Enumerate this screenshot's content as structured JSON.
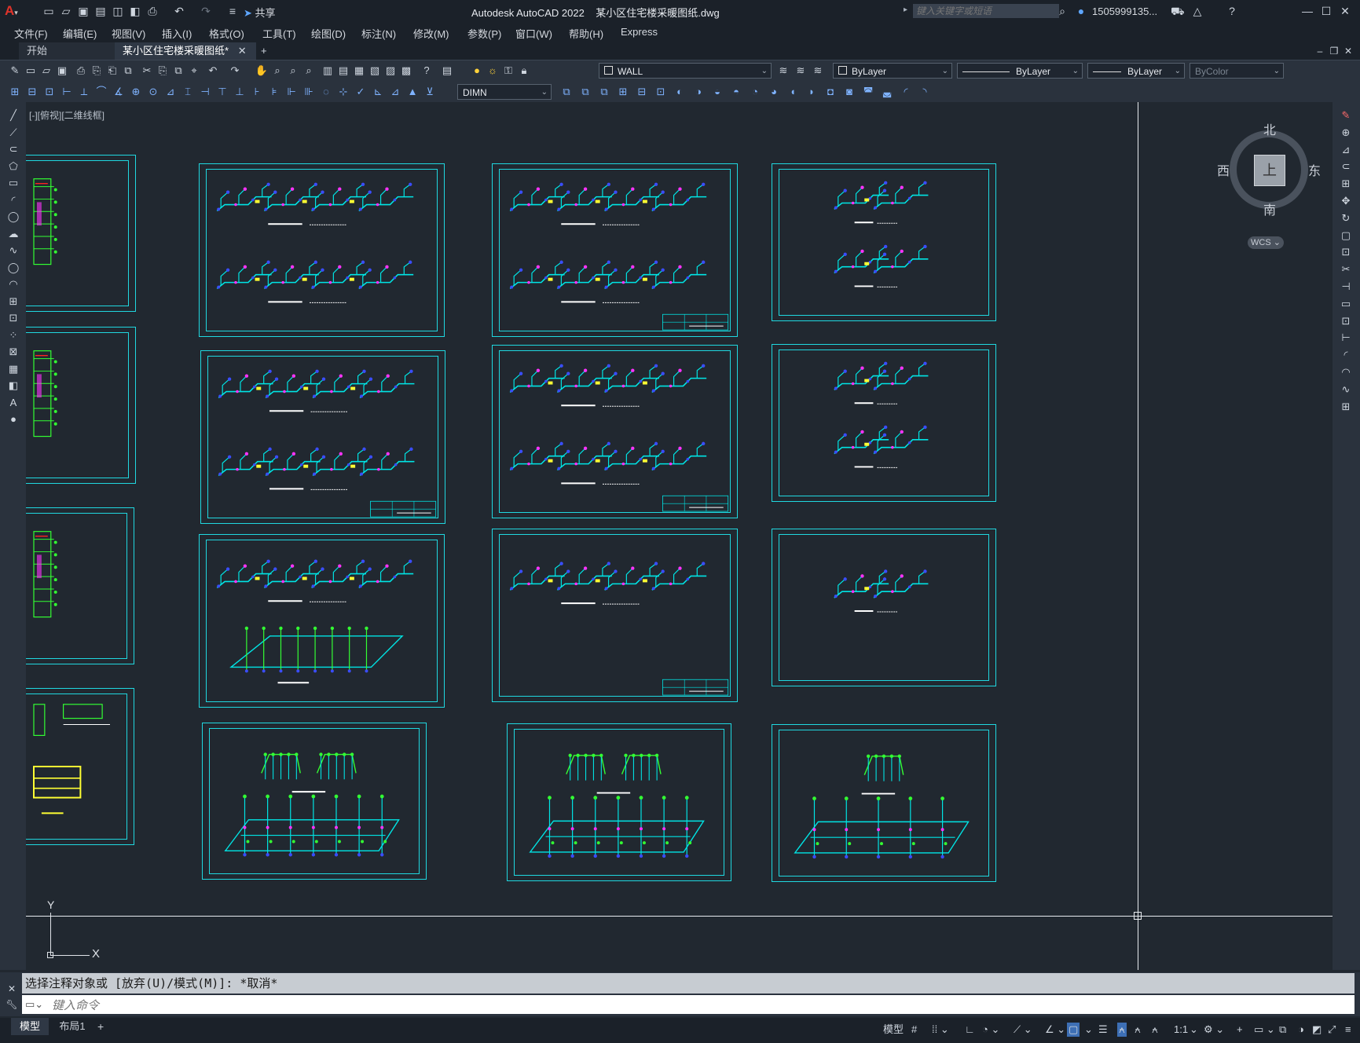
{
  "app": {
    "title": "Autodesk AutoCAD 2022",
    "document": "某小区住宅楼采暖图纸.dwg",
    "search_placeholder": "键入关键字或短语",
    "user": "1505999135...",
    "share": "共享"
  },
  "menu": [
    "文件(F)",
    "编辑(E)",
    "视图(V)",
    "插入(I)",
    "格式(O)",
    "工具(T)",
    "绘图(D)",
    "标注(N)",
    "修改(M)",
    "参数(P)",
    "窗口(W)",
    "帮助(H)",
    "Express"
  ],
  "tabs": [
    {
      "label": "开始"
    },
    {
      "label": "某小区住宅楼采暖图纸*"
    }
  ],
  "toolbar": {
    "layer": "WALL",
    "color": "ByLayer",
    "linetype": "ByLayer",
    "lineweight": "ByLayer",
    "plotstyle": "ByColor",
    "dimstyle": "DIMN"
  },
  "viewport": {
    "label": "[-][俯视][二维线框]"
  },
  "viewcube": {
    "north": "北",
    "south": "南",
    "east": "东",
    "west": "西",
    "face": "上",
    "wcs": "WCS"
  },
  "ucs": {
    "x": "X",
    "y": "Y"
  },
  "command": {
    "history": "选择注释对象或 [放弃(U)/模式(M)]: *取消*",
    "placeholder": "键入命令"
  },
  "status": {
    "model": "模型",
    "layout1": "布局1",
    "model_btn": "模型",
    "scale": "1:1"
  },
  "colors": {
    "frame": "#20d8e0",
    "pipe": "#00e5e5",
    "green": "#33ff33",
    "blue": "#3a4dff",
    "magenta": "#ff33ff",
    "yellow": "#ffff33",
    "red": "#ff2222"
  }
}
